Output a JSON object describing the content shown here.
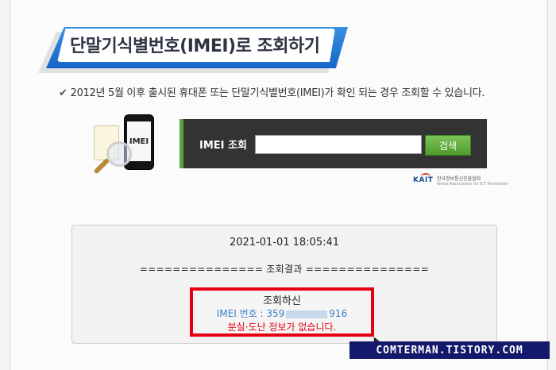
{
  "page": {
    "title": "단말기식별번호(IMEI)로 조회하기",
    "notice": "2012년 5월 이후 출시된 휴대폰 또는 단말기식별번호(IMEI)가 확인 되는 경우 조회할 수 있습니다."
  },
  "phone_graphic": {
    "screen_text": "IMEI"
  },
  "search": {
    "label": "IMEI 조회",
    "input_value": "",
    "button_label": "검색"
  },
  "logo": {
    "mark": "KAIT",
    "name": "한국정보통신진흥협회",
    "subtitle": "Korea Association for ICT Promotion"
  },
  "result": {
    "datetime": "2021-01-01 18:05:41",
    "divider": "=============== 조회결과 ===============",
    "heading": "조회하신",
    "imei_prefix": "IMEI 번호 : 359",
    "imei_suffix": "916",
    "status": "분실·도난 정보가 없습니다."
  },
  "watermark": "COMTERMAN.TISTORY.COM",
  "colors": {
    "banner_blue": "#1467c8",
    "panel_dark": "#333333",
    "button_green": "#5aa33a",
    "alert_red": "#e60012",
    "imei_blue": "#3a7fc4",
    "watermark_navy": "#141a6b"
  }
}
